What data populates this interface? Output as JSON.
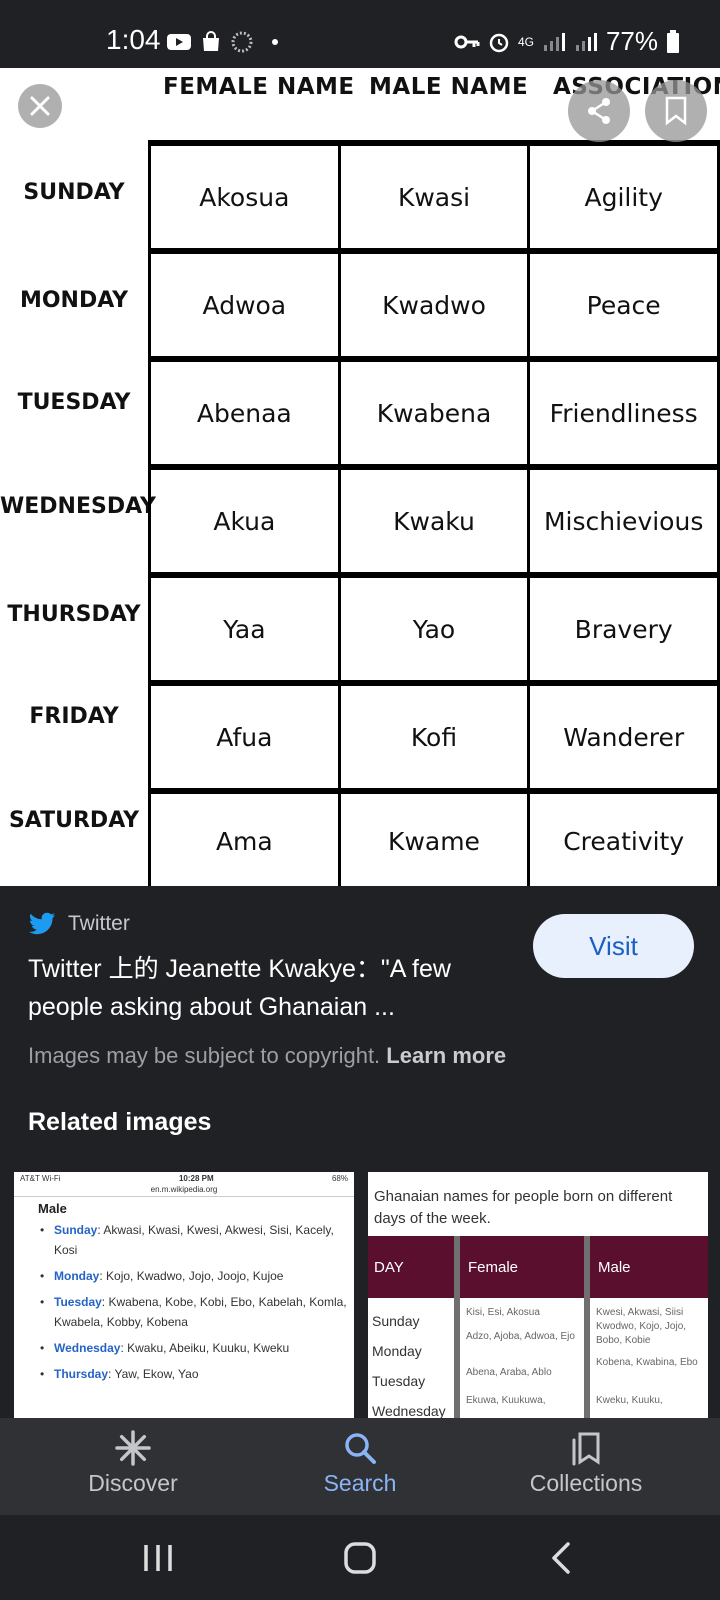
{
  "status_bar": {
    "time": "1:04",
    "network": "4G",
    "battery": "77%"
  },
  "image": {
    "headers": [
      "FEMALE NAME",
      "MALE NAME",
      "ASSOCIATION"
    ],
    "rows": [
      {
        "day": "SUNDAY",
        "female": "Akosua",
        "male": "Kwasi",
        "association": "Agility"
      },
      {
        "day": "MONDAY",
        "female": "Adwoa",
        "male": "Kwadwo",
        "association": "Peace"
      },
      {
        "day": "TUESDAY",
        "female": "Abenaa",
        "male": "Kwabena",
        "association": "Friendliness"
      },
      {
        "day": "WEDNESDAY",
        "female": "Akua",
        "male": "Kwaku",
        "association": "Mischievious"
      },
      {
        "day": "THURSDAY",
        "female": "Yaa",
        "male": "Yao",
        "association": "Bravery"
      },
      {
        "day": "FRIDAY",
        "female": "Afua",
        "male": "Kofi",
        "association": "Wanderer"
      },
      {
        "day": "SATURDAY",
        "female": "Ama",
        "male": "Kwame",
        "association": "Creativity"
      }
    ]
  },
  "result": {
    "source": "Twitter",
    "title": "Twitter 上的 Jeanette Kwakye：\"A few people asking about Ghanaian ...",
    "visit_label": "Visit",
    "copyright_text": "Images may be subject to copyright.",
    "learn_more": "Learn more"
  },
  "related": {
    "heading": "Related images",
    "thumb1": {
      "carrier": "AT&T Wi-Fi",
      "time": "10:28 PM",
      "battery": "68%",
      "url": "en.m.wikipedia.org",
      "heading": "Male",
      "items": [
        {
          "day": "Sunday",
          "names": "Akwasi, Kwasi, Kwesi, Akwesi, Sisi, Kacely, Kosi"
        },
        {
          "day": "Monday",
          "names": "Kojo, Kwadwo, Jojo, Joojo, Kujoe"
        },
        {
          "day": "Tuesday",
          "names": "Kwabena, Kobe, Kobi, Ebo, Kabelah, Komla, Kwabela, Kobby, Kobena"
        },
        {
          "day": "Wednesday",
          "names": "Kwaku, Abeiku, Kuuku, Kweku"
        },
        {
          "day": "Thursday",
          "names": "Yaw, Ekow, Yao"
        }
      ]
    },
    "thumb2": {
      "caption": "Ghanaian names for people born on different days of the week.",
      "headers": [
        "DAY",
        "Female",
        "Male"
      ],
      "days": [
        "Sunday",
        "Monday",
        "Tuesday",
        "Wednesday"
      ],
      "female": [
        "Kisi, Esi, Akosua",
        "Adzo, Ajoba, Adwoa, Ejo",
        "Abena, Araba, Ablo",
        "Ekuwa, Kuukuwa,"
      ],
      "male": [
        "Kwesi, Akwasi, Siisi",
        "Kwodwo, Kojo, Jojo, Bobo, Kobie",
        "Kobena, Kwabina, Ebo",
        "Kweku, Kuuku,"
      ]
    }
  },
  "bottom_nav": {
    "discover": "Discover",
    "search": "Search",
    "collections": "Collections"
  },
  "colors": {
    "background": "#202124",
    "accent": "#8ab4f8",
    "visit_bg": "#e8f0fe",
    "twitter": "#1d9bf0",
    "thumb_header": "#5a0f2f"
  }
}
